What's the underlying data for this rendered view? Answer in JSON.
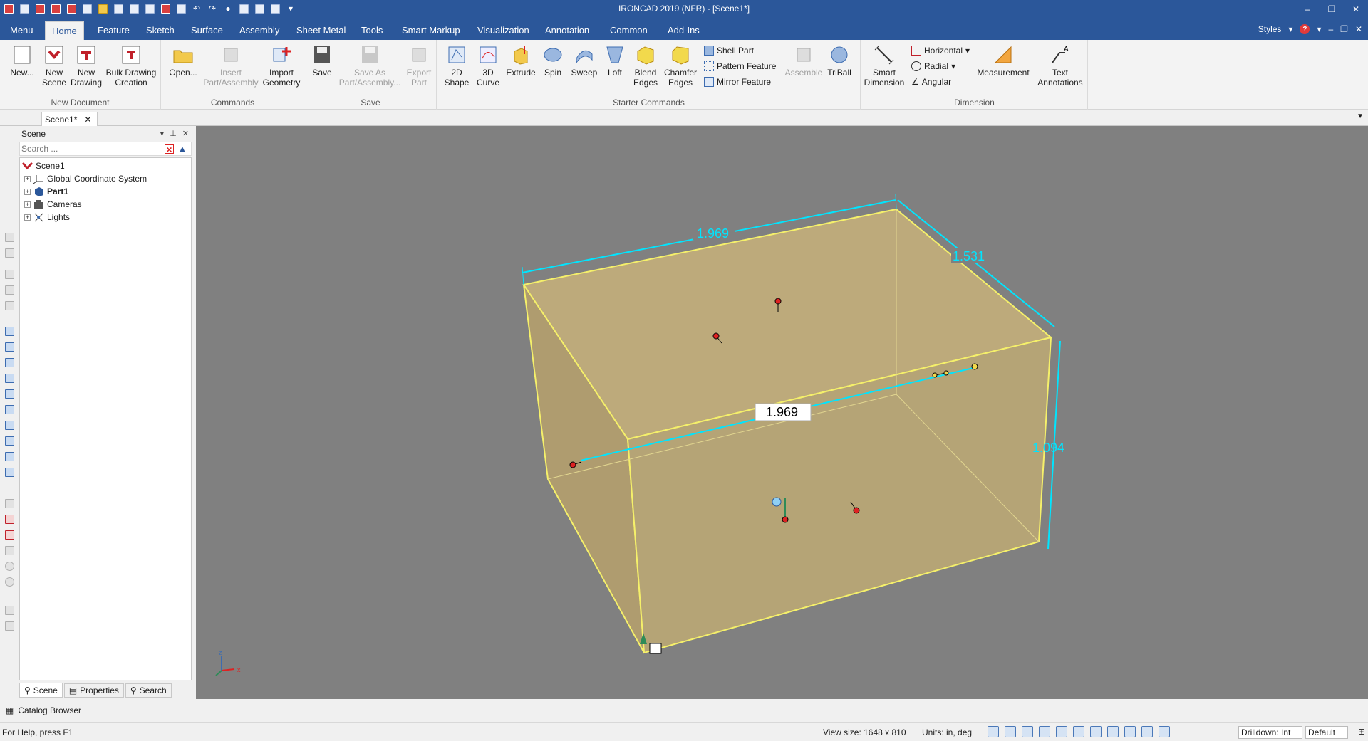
{
  "window": {
    "title": "IRONCAD 2019 (NFR) - [Scene1*]"
  },
  "ribbon_tabs": [
    "Menu",
    "Home",
    "Feature",
    "Sketch",
    "Surface",
    "Assembly",
    "Sheet Metal",
    "Tools",
    "Smart Markup",
    "Visualization",
    "Annotation",
    "Common",
    "Add-Ins"
  ],
  "active_tab": "Home",
  "styles_label": "Styles",
  "groups": {
    "new_document": {
      "label": "New Document",
      "buttons": [
        "New...",
        "New Scene",
        "New Drawing",
        "Bulk Drawing Creation"
      ]
    },
    "commands": {
      "label": "Commands",
      "buttons": [
        "Open...",
        "Insert Part/Assembly",
        "Import Geometry"
      ]
    },
    "save": {
      "label": "Save",
      "buttons": [
        "Save",
        "Save As Part/Assembly...",
        "Export Part"
      ]
    },
    "starter": {
      "label": "Starter Commands",
      "buttons": [
        "2D Shape",
        "3D Curve",
        "Extrude",
        "Spin",
        "Sweep",
        "Loft",
        "Blend Edges",
        "Chamfer Edges"
      ],
      "small": [
        "Shell Part",
        "Pattern Feature",
        "Mirror Feature"
      ],
      "more": [
        "Assemble",
        "TriBall"
      ]
    },
    "dimension": {
      "label": "Dimension",
      "buttons": [
        "Smart Dimension",
        "Measurement",
        "Text Annotations"
      ],
      "small": [
        "Horizontal",
        "Radial",
        "Angular"
      ]
    }
  },
  "doc_tab": "Scene1*",
  "panel": {
    "title": "Scene",
    "search_placeholder": "Search ...",
    "tree": [
      {
        "label": "Scene1",
        "level": 0
      },
      {
        "label": "Global Coordinate System",
        "level": 1
      },
      {
        "label": "Part1",
        "level": 1
      },
      {
        "label": "Cameras",
        "level": 1
      },
      {
        "label": "Lights",
        "level": 1
      }
    ],
    "tabs": [
      "Scene",
      "Properties",
      "Search"
    ]
  },
  "viewport": {
    "dimensions": {
      "top_width": "1.969",
      "depth": "1.531",
      "height": "1.094",
      "edit_value": "1.969"
    },
    "axis_labels": {
      "z": "z",
      "x": "x"
    }
  },
  "catalog_label": "Catalog Browser",
  "status": {
    "help": "For Help, press F1",
    "view_size": "View size: 1648 x  810",
    "units": "Units: in, deg",
    "drilldown": "Drilldown: Int",
    "default": "Default"
  },
  "colors": {
    "titlebar": "#2b579a",
    "viewport": "#808080",
    "dimension": "#00e5ff",
    "box_edge": "#f5f06a"
  }
}
